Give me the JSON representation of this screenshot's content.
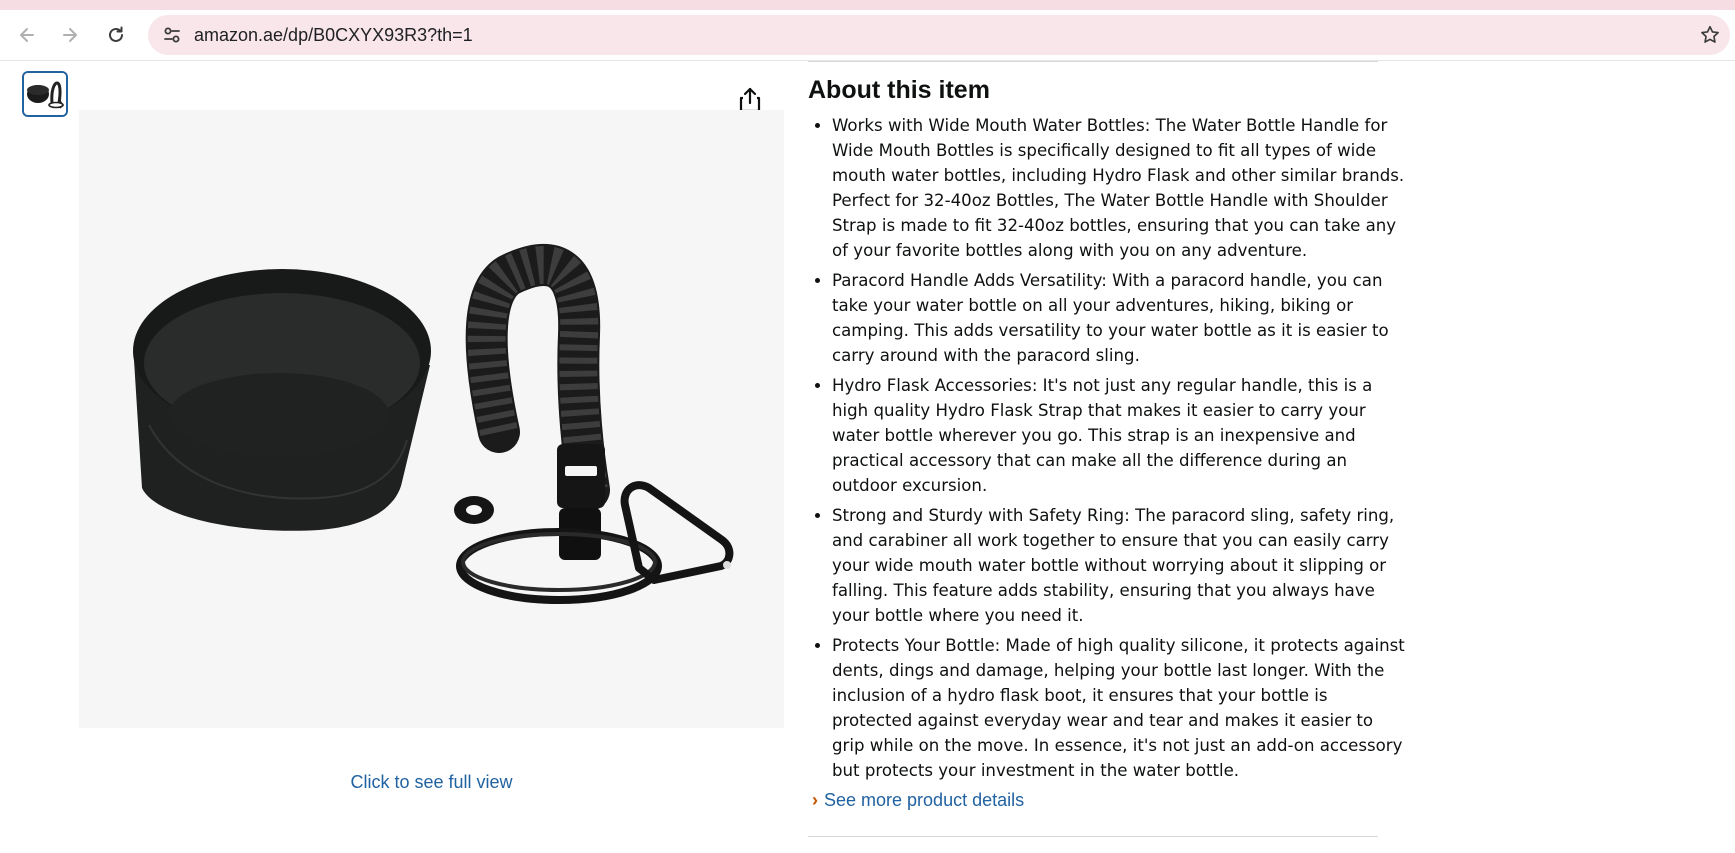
{
  "browser": {
    "url": "amazon.ae/dp/B0CXYX93R3?th=1",
    "icons": [
      "back-arrow-icon",
      "forward-arrow-icon",
      "reload-icon",
      "site-info-icon",
      "bookmark-star-icon"
    ]
  },
  "gallery": {
    "full_view_link": "Click to see full view",
    "icons": [
      "share-icon"
    ]
  },
  "about": {
    "heading": "About this item",
    "bullets": [
      "Works with Wide Mouth Water Bottles: The Water Bottle Handle for Wide Mouth Bottles is specifically designed to fit all types of wide mouth water bottles, including Hydro Flask and other similar brands. Perfect for 32-40oz Bottles, The Water Bottle Handle with Shoulder Strap is made to fit 32-40oz bottles, ensuring that you can take any of your favorite bottles along with you on any adventure.",
      "Paracord Handle Adds Versatility: With a paracord handle, you can take your water bottle on all your adventures, hiking, biking or camping. This adds versatility to your water bottle as it is easier to carry around with the paracord sling.",
      "Hydro Flask Accessories: It's not just any regular handle, this is a high quality Hydro Flask Strap that makes it easier to carry your water bottle wherever you go. This strap is an inexpensive and practical accessory that can make all the difference during an outdoor excursion.",
      "Strong and Sturdy with Safety Ring: The paracord sling, safety ring, and carabiner all work together to ensure that you can easily carry your wide mouth water bottle without worrying about it slipping or falling. This feature adds stability, ensuring that you always have your bottle where you need it.",
      "Protects Your Bottle: Made of high quality silicone, it protects against dents, dings and damage, helping your bottle last longer. With the inclusion of a hydro flask boot, it ensures that your bottle is protected against everyday wear and tear and makes it easier to grip while on the move. In essence, it's not just an add-on accessory but protects your investment in the water bottle."
    ],
    "see_more_chevron": "›",
    "see_more_label": "See more product details"
  },
  "colors": {
    "link": "#2162a1",
    "chevron": "#c45500",
    "text": "#0f1111",
    "image_bg": "#f6f6f6",
    "omnibox_bg": "#f8e6ea"
  }
}
